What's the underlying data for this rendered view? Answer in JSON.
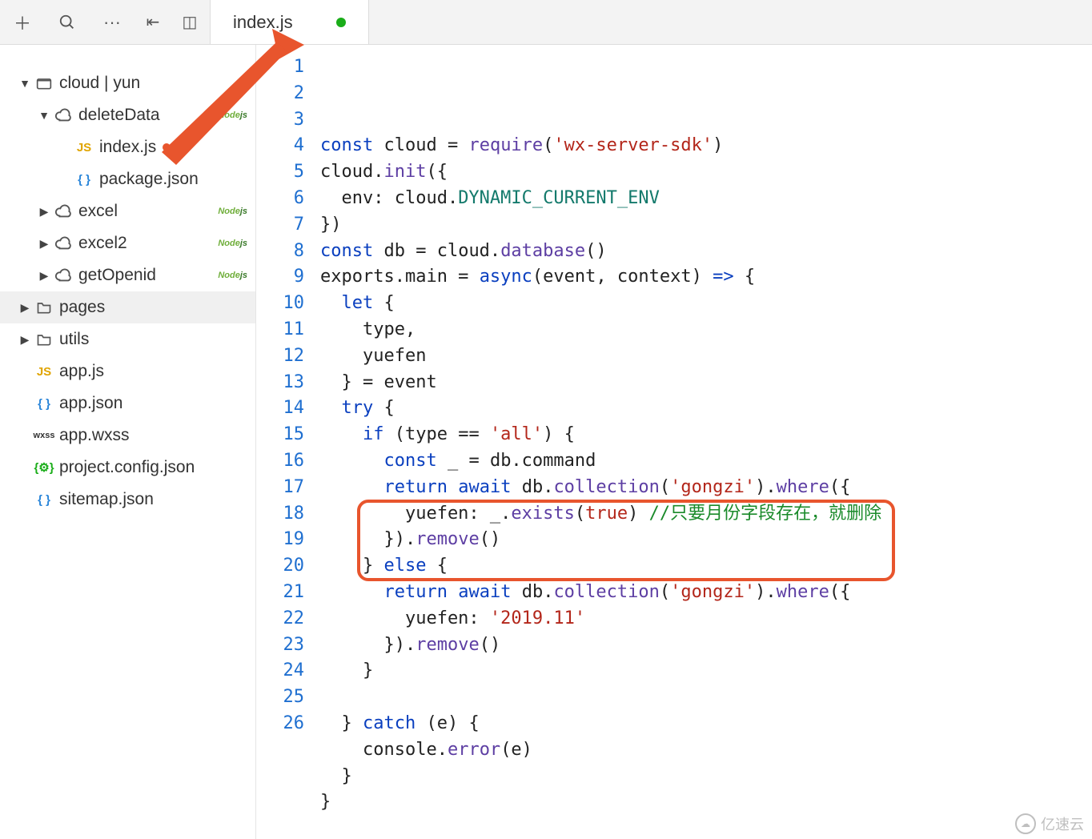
{
  "tab": {
    "title": "index.js"
  },
  "toolbar": {
    "add_tip": "+",
    "search_tip": "search",
    "more_tip": "···",
    "collapse_tip": "collapse",
    "split_tip": "split"
  },
  "tree": {
    "root": {
      "label": "cloud | yun"
    },
    "items": [
      {
        "label": "deleteData",
        "kind": "cloud",
        "open": true,
        "node": true,
        "depth": 1
      },
      {
        "label": "index.js",
        "kind": "js",
        "depth": 2,
        "dirty": true
      },
      {
        "label": "package.json",
        "kind": "json",
        "depth": 2
      },
      {
        "label": "excel",
        "kind": "cloud",
        "node": true,
        "depth": 1
      },
      {
        "label": "excel2",
        "kind": "cloud",
        "node": true,
        "depth": 1
      },
      {
        "label": "getOpenid",
        "kind": "cloud",
        "node": true,
        "depth": 1
      },
      {
        "label": "pages",
        "kind": "folder",
        "depth": 0,
        "sel": true
      },
      {
        "label": "utils",
        "kind": "folder",
        "depth": 0
      },
      {
        "label": "app.js",
        "kind": "js",
        "depth": 0
      },
      {
        "label": "app.json",
        "kind": "json",
        "depth": 0
      },
      {
        "label": "app.wxss",
        "kind": "wxss",
        "depth": 0
      },
      {
        "label": "project.config.json",
        "kind": "cfg",
        "depth": 0
      },
      {
        "label": "sitemap.json",
        "kind": "json",
        "depth": 0
      }
    ]
  },
  "code": {
    "lines": [
      [
        [
          "kw",
          "const"
        ],
        [
          "plain",
          " cloud = "
        ],
        [
          "fn",
          "require"
        ],
        [
          "plain",
          "("
        ],
        [
          "str",
          "'wx-server-sdk'"
        ],
        [
          "plain",
          ")"
        ]
      ],
      [
        [
          "plain",
          "cloud."
        ],
        [
          "fn",
          "init"
        ],
        [
          "plain",
          "({"
        ]
      ],
      [
        [
          "plain",
          "  env: cloud."
        ],
        [
          "prop",
          "DYNAMIC_CURRENT_ENV"
        ]
      ],
      [
        [
          "plain",
          "})"
        ]
      ],
      [
        [
          "kw",
          "const"
        ],
        [
          "plain",
          " db = cloud."
        ],
        [
          "fn",
          "database"
        ],
        [
          "plain",
          "()"
        ]
      ],
      [
        [
          "plain",
          "exports.main = "
        ],
        [
          "async",
          "async"
        ],
        [
          "plain",
          "(event, context) "
        ],
        [
          "arrow",
          "=>"
        ],
        [
          "plain",
          " {"
        ]
      ],
      [
        [
          "plain",
          "  "
        ],
        [
          "kw",
          "let"
        ],
        [
          "plain",
          " {"
        ]
      ],
      [
        [
          "plain",
          "    type,"
        ]
      ],
      [
        [
          "plain",
          "    yuefen"
        ]
      ],
      [
        [
          "plain",
          "  } = event"
        ]
      ],
      [
        [
          "plain",
          "  "
        ],
        [
          "kw",
          "try"
        ],
        [
          "plain",
          " {"
        ]
      ],
      [
        [
          "plain",
          "    "
        ],
        [
          "kw",
          "if"
        ],
        [
          "plain",
          " (type == "
        ],
        [
          "str",
          "'all'"
        ],
        [
          "plain",
          ") {"
        ]
      ],
      [
        [
          "plain",
          "      "
        ],
        [
          "kw",
          "const"
        ],
        [
          "plain",
          " _ = db.command"
        ]
      ],
      [
        [
          "plain",
          "      "
        ],
        [
          "kw",
          "return"
        ],
        [
          "plain",
          " "
        ],
        [
          "kw",
          "await"
        ],
        [
          "plain",
          " db."
        ],
        [
          "fn",
          "collection"
        ],
        [
          "plain",
          "("
        ],
        [
          "str",
          "'gongzi'"
        ],
        [
          "plain",
          ")."
        ],
        [
          "fn",
          "where"
        ],
        [
          "plain",
          "({"
        ]
      ],
      [
        [
          "plain",
          "        yuefen: _."
        ],
        [
          "fn",
          "exists"
        ],
        [
          "plain",
          "("
        ],
        [
          "bool",
          "true"
        ],
        [
          "plain",
          ") "
        ],
        [
          "cmt",
          "//只要月份字段存在，就删除"
        ]
      ],
      [
        [
          "plain",
          "      })."
        ],
        [
          "fn",
          "remove"
        ],
        [
          "plain",
          "()"
        ]
      ],
      [
        [
          "plain",
          "    } "
        ],
        [
          "kw",
          "else"
        ],
        [
          "plain",
          " {"
        ]
      ],
      [
        [
          "plain",
          "      "
        ],
        [
          "kw",
          "return"
        ],
        [
          "plain",
          " "
        ],
        [
          "kw",
          "await"
        ],
        [
          "plain",
          " db."
        ],
        [
          "fn",
          "collection"
        ],
        [
          "plain",
          "("
        ],
        [
          "str",
          "'gongzi'"
        ],
        [
          "plain",
          ")."
        ],
        [
          "fn",
          "where"
        ],
        [
          "plain",
          "({"
        ]
      ],
      [
        [
          "plain",
          "        yuefen: "
        ],
        [
          "str",
          "'2019.11'"
        ]
      ],
      [
        [
          "plain",
          "      })."
        ],
        [
          "fn",
          "remove"
        ],
        [
          "plain",
          "()"
        ]
      ],
      [
        [
          "plain",
          "    }"
        ]
      ],
      [
        [
          "plain",
          ""
        ]
      ],
      [
        [
          "plain",
          "  } "
        ],
        [
          "kw",
          "catch"
        ],
        [
          "plain",
          " (e) {"
        ]
      ],
      [
        [
          "plain",
          "    console."
        ],
        [
          "fn",
          "error"
        ],
        [
          "plain",
          "(e)"
        ]
      ],
      [
        [
          "plain",
          "  }"
        ]
      ],
      [
        [
          "plain",
          "}"
        ]
      ]
    ]
  },
  "watermark": "亿速云"
}
